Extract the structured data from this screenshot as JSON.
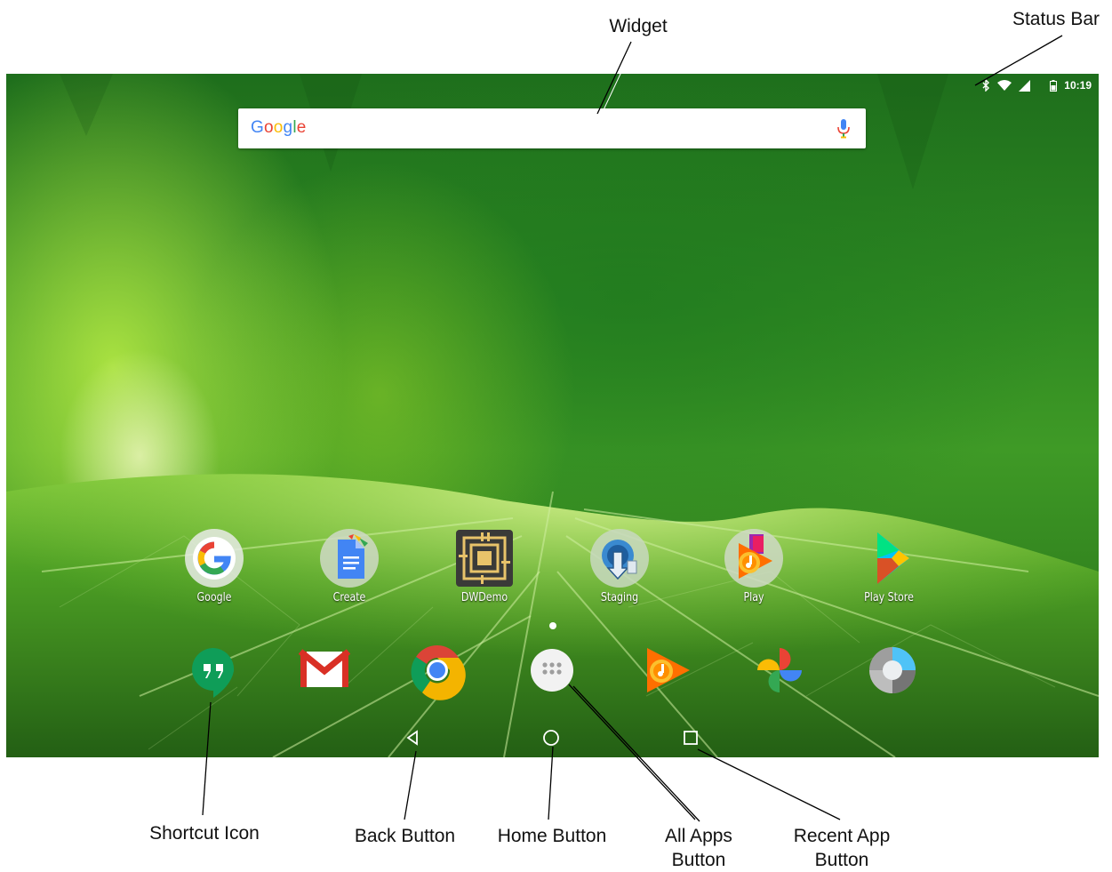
{
  "status_bar": {
    "time": "10:19",
    "icons": [
      "bluetooth-icon",
      "wifi-icon",
      "cell-signal-icon",
      "battery-icon"
    ]
  },
  "widget": {
    "logo_text": "Google",
    "logo_letters": [
      "G",
      "o",
      "o",
      "g",
      "l",
      "e"
    ],
    "logo_colors": [
      "#4285F4",
      "#EA4335",
      "#FBBC05",
      "#4285F4",
      "#34A853",
      "#EA4335"
    ],
    "mic_icon": "mic-icon"
  },
  "home_apps": [
    {
      "label": "Google",
      "icon": "google-icon"
    },
    {
      "label": "Create",
      "icon": "docs-icon"
    },
    {
      "label": "DWDemo",
      "icon": "dwdemo-icon"
    },
    {
      "label": "Staging",
      "icon": "staging-icon"
    },
    {
      "label": "Play",
      "icon": "play-music-icon"
    },
    {
      "label": "Play Store",
      "icon": "play-store-icon"
    }
  ],
  "dock_icons": [
    "hangouts-icon",
    "gmail-icon",
    "chrome-icon",
    "all-apps-icon",
    "play-music-icon",
    "photos-icon",
    "google-camera-icon"
  ],
  "nav_bar": [
    "back-icon",
    "home-icon",
    "recents-icon"
  ],
  "callouts": {
    "widget": "Widget",
    "status_bar": "Status Bar",
    "shortcut_icon": "Shortcut Icon",
    "back_button": "Back Button",
    "home_button": "Home Button",
    "all_apps_1": "All Apps",
    "all_apps_2": "Button",
    "recent_app_1": "Recent App",
    "recent_app_2": "Button"
  },
  "colors": {
    "google_blue": "#4285F4",
    "google_red": "#EA4335",
    "google_yellow": "#FBBC05",
    "google_green": "#34A853"
  }
}
